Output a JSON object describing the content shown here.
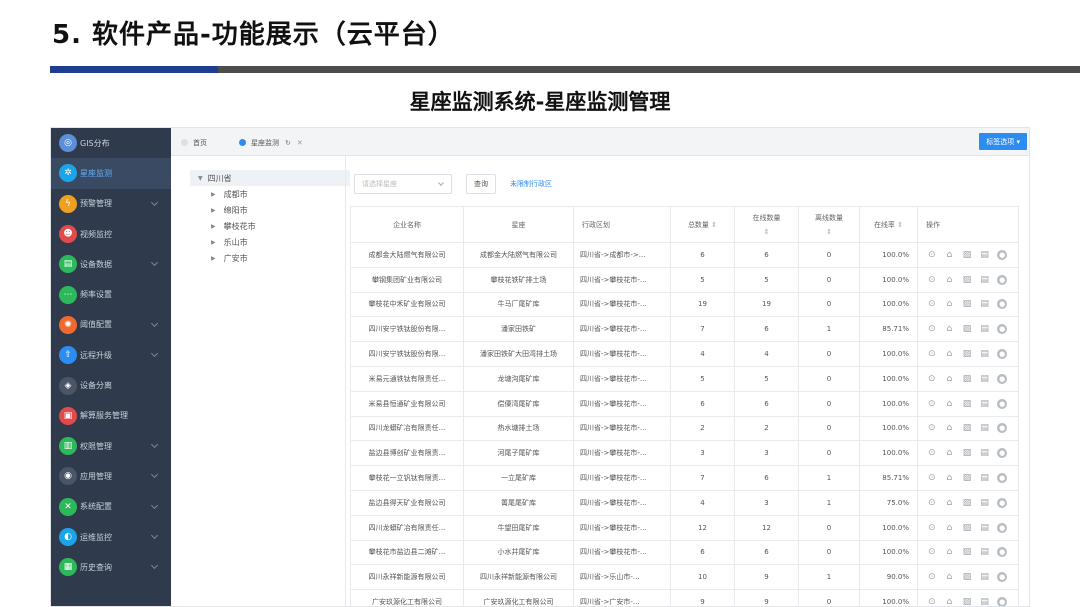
{
  "slide": {
    "title": "5. 软件产品-功能展示（云平台）",
    "subtitle": "星座监测系统-星座监测管理"
  },
  "colors": {
    "accent": "#2d8cf0",
    "sidebar": "#2f3a4c",
    "title_accent": "#1e3f8f"
  },
  "sidebar": {
    "items": [
      {
        "label": "GIS分布",
        "icon": "globe-icon",
        "color": "#5b8fd8",
        "active": false,
        "chevron": false
      },
      {
        "label": "星座监测",
        "icon": "gear-icon",
        "color": "#1ba5e8",
        "active": true,
        "chevron": false
      },
      {
        "label": "预警管理",
        "icon": "lightning-icon",
        "color": "#f0a020",
        "active": false,
        "chevron": true
      },
      {
        "label": "视频监控",
        "icon": "users-icon",
        "color": "#e24b4b",
        "active": false,
        "chevron": false
      },
      {
        "label": "设备数据",
        "icon": "document-icon",
        "color": "#2eb85c",
        "active": false,
        "chevron": true
      },
      {
        "label": "频率设置",
        "icon": "dots-icon",
        "color": "#2eb85c",
        "active": false,
        "chevron": false
      },
      {
        "label": "阈值配置",
        "icon": "settings-icon",
        "color": "#f06a30",
        "active": false,
        "chevron": true
      },
      {
        "label": "远程升级",
        "icon": "upload-icon",
        "color": "#2d8cf0",
        "active": false,
        "chevron": true
      },
      {
        "label": "设备分离",
        "icon": "layers-icon",
        "color": "#4a5568",
        "active": false,
        "chevron": false
      },
      {
        "label": "解算服务管理",
        "icon": "server-icon",
        "color": "#e24b4b",
        "active": false,
        "chevron": false
      },
      {
        "label": "权限管理",
        "icon": "lock-icon",
        "color": "#2eb85c",
        "active": false,
        "chevron": true
      },
      {
        "label": "应用管理",
        "icon": "app-icon",
        "color": "#4a5568",
        "active": false,
        "chevron": true
      },
      {
        "label": "系统配置",
        "icon": "wrench-icon",
        "color": "#2eb85c",
        "active": false,
        "chevron": true
      },
      {
        "label": "运维监控",
        "icon": "monitor-icon",
        "color": "#1ba5e8",
        "active": false,
        "chevron": true
      },
      {
        "label": "历史查询",
        "icon": "history-icon",
        "color": "#2eb85c",
        "active": false,
        "chevron": true
      }
    ]
  },
  "tabs": {
    "home": "首页",
    "current": "星座监测",
    "right_button": "标签选项 ▾"
  },
  "tree": {
    "root": "四川省",
    "children": [
      "成都市",
      "绵阳市",
      "攀枝花市",
      "乐山市",
      "广安市"
    ]
  },
  "toolbar": {
    "select_placeholder": "请选择星座",
    "query_label": "查询",
    "link_label": "未限制行政区"
  },
  "table": {
    "headers": {
      "company": "企业名称",
      "constellation": "星座",
      "region": "行政区划",
      "total": "总数量",
      "online": "在线数量",
      "offline": "离线数量",
      "rate": "在线率",
      "ops": "操作"
    },
    "rows": [
      {
        "company": "成都金大陆燃气有限公司",
        "constellation": "成都金大陆燃气有限公司",
        "region": "四川省->成都市->...",
        "total": "6",
        "online": "6",
        "offline": "0",
        "rate": "100.0%"
      },
      {
        "company": "攀钢集团矿业有限公司",
        "constellation": "攀枝花铁矿排土场",
        "region": "四川省->攀枝花市-...",
        "total": "5",
        "online": "5",
        "offline": "0",
        "rate": "100.0%"
      },
      {
        "company": "攀枝花中禾矿业有限公司",
        "constellation": "牛马厂尾矿库",
        "region": "四川省->攀枝花市-...",
        "total": "19",
        "online": "19",
        "offline": "0",
        "rate": "100.0%"
      },
      {
        "company": "四川安宁铁钛股份有限...",
        "constellation": "潘家田铁矿",
        "region": "四川省->攀枝花市-...",
        "total": "7",
        "online": "6",
        "offline": "1",
        "rate": "85.71%"
      },
      {
        "company": "四川安宁铁钛股份有限...",
        "constellation": "潘家田铁矿大田湾排土场",
        "region": "四川省->攀枝花市-...",
        "total": "4",
        "online": "4",
        "offline": "0",
        "rate": "100.0%"
      },
      {
        "company": "米易元通铁钛有限责任...",
        "constellation": "龙塘沟尾矿库",
        "region": "四川省->攀枝花市-...",
        "total": "5",
        "online": "5",
        "offline": "0",
        "rate": "100.0%"
      },
      {
        "company": "米易县恒通矿业有限公司",
        "constellation": "偿僳湾尾矿库",
        "region": "四川省->攀枝花市-...",
        "total": "6",
        "online": "6",
        "offline": "0",
        "rate": "100.0%"
      },
      {
        "company": "四川龙蟒矿冶有限责任...",
        "constellation": "热水塘排土场",
        "region": "四川省->攀枝花市-...",
        "total": "2",
        "online": "2",
        "offline": "0",
        "rate": "100.0%"
      },
      {
        "company": "盐边县博创矿业有限责...",
        "constellation": "河尾子尾矿库",
        "region": "四川省->攀枝花市-...",
        "total": "3",
        "online": "3",
        "offline": "0",
        "rate": "100.0%"
      },
      {
        "company": "攀枝花一立钒钛有限责...",
        "constellation": "一立尾矿库",
        "region": "四川省->攀枝花市-...",
        "total": "7",
        "online": "6",
        "offline": "1",
        "rate": "85.71%"
      },
      {
        "company": "盐边县得天矿业有限公司",
        "constellation": "箐尾尾矿库",
        "region": "四川省->攀枝花市-...",
        "total": "4",
        "online": "3",
        "offline": "1",
        "rate": "75.0%"
      },
      {
        "company": "四川龙蟒矿冶有限责任...",
        "constellation": "牛望田尾矿库",
        "region": "四川省->攀枝花市-...",
        "total": "12",
        "online": "12",
        "offline": "0",
        "rate": "100.0%"
      },
      {
        "company": "攀枝花市盐边县二滩矿...",
        "constellation": "小水井尾矿库",
        "region": "四川省->攀枝花市-...",
        "total": "6",
        "online": "6",
        "offline": "0",
        "rate": "100.0%"
      },
      {
        "company": "四川永祥新能源有限公司",
        "constellation": "四川永祥新能源有限公司",
        "region": "四川省->乐山市-...",
        "total": "10",
        "online": "9",
        "offline": "1",
        "rate": "90.0%"
      },
      {
        "company": "广安玖源化工有限公司",
        "constellation": "广安玖源化工有限公司",
        "region": "四川省->广安市-...",
        "total": "9",
        "online": "9",
        "offline": "0",
        "rate": "100.0%"
      }
    ],
    "op_icons": [
      "location-icon",
      "camera-icon",
      "image-icon",
      "file-icon",
      "user-icon"
    ]
  }
}
